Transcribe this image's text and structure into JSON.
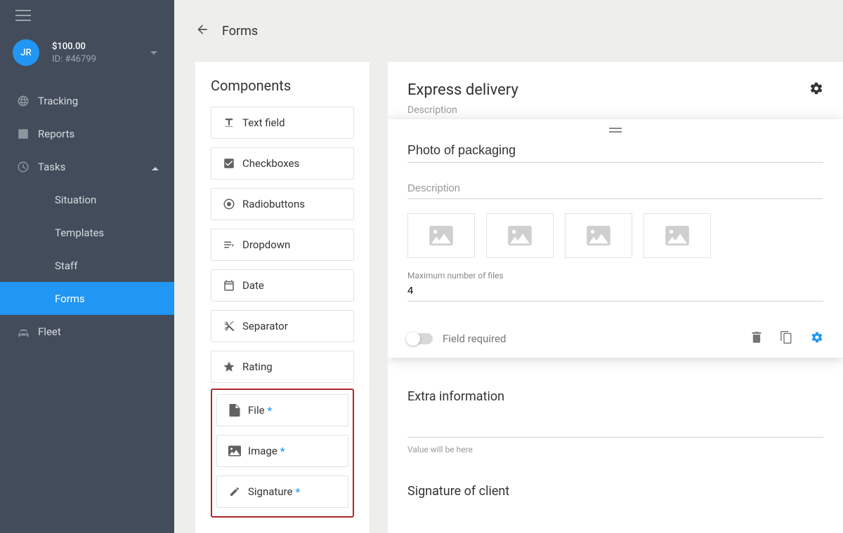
{
  "account": {
    "initials": "JR",
    "balance": "$100.00",
    "id_label": "ID: #46799"
  },
  "nav": {
    "tracking": "Tracking",
    "reports": "Reports",
    "tasks": "Tasks",
    "situation": "Situation",
    "templates": "Templates",
    "staff": "Staff",
    "forms": "Forms",
    "fleet": "Fleet"
  },
  "topbar": {
    "title": "Forms"
  },
  "components": {
    "heading": "Components",
    "text_field": "Text field",
    "checkboxes": "Checkboxes",
    "radiobuttons": "Radiobuttons",
    "dropdown": "Dropdown",
    "date": "Date",
    "separator": "Separator",
    "rating": "Rating",
    "file": "File",
    "image": "Image",
    "signature": "Signature",
    "asterisk": "*"
  },
  "form": {
    "title": "Express delivery",
    "desc_label": "Description"
  },
  "field_card": {
    "title_value": "Photo of packaging",
    "desc_placeholder": "Description",
    "max_files_label": "Maximum number of files",
    "max_files_value": "4",
    "required_label": "Field required"
  },
  "sections": {
    "extra_info": "Extra information",
    "value_hint": "Value will be here",
    "signature": "Signature of client"
  }
}
